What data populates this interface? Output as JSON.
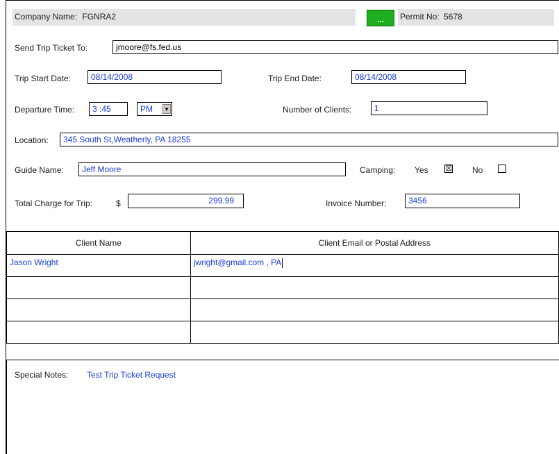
{
  "company": {
    "label": "Company Name:",
    "value": "FGNRA2",
    "lookup_button": "...",
    "permit_label": "Permit No:",
    "permit_value": "5678"
  },
  "send_to": {
    "label": "Send Trip Ticket To:",
    "value": "jmoore@fs.fed.us"
  },
  "start_date": {
    "label": "Trip Start Date:",
    "value": "08/14/2008"
  },
  "end_date": {
    "label": "Trip End Date:",
    "value": "08/14/2008"
  },
  "departure": {
    "label": "Departure Time:",
    "value": "3 :45",
    "ampm": "PM"
  },
  "clients_count": {
    "label": "Number of Clients:",
    "value": "1"
  },
  "location": {
    "label": "Location:",
    "value": "345 South St,Weatherly, PA 18255"
  },
  "guide": {
    "label": "Guide Name:",
    "value": "Jeff Moore"
  },
  "camping": {
    "label": "Camping:",
    "yes_label": "Yes",
    "no_label": "No",
    "yes_checked": true,
    "no_checked": false,
    "yes_mark": "☒",
    "no_mark": ""
  },
  "total": {
    "label": "Total Charge for Trip:",
    "currency": "$",
    "value": "299.99"
  },
  "invoice": {
    "label": "Invoice Number:",
    "value": "3456"
  },
  "clients_table": {
    "headers": [
      "Client Name",
      "Client Email or Postal Address"
    ],
    "rows": [
      [
        "Jason Wright",
        "jwright@gmail.com , PA"
      ],
      [
        "",
        ""
      ],
      [
        "",
        ""
      ],
      [
        "",
        ""
      ]
    ]
  },
  "notes": {
    "label": "Special Notes:",
    "value": "Test Trip Ticket Request"
  }
}
